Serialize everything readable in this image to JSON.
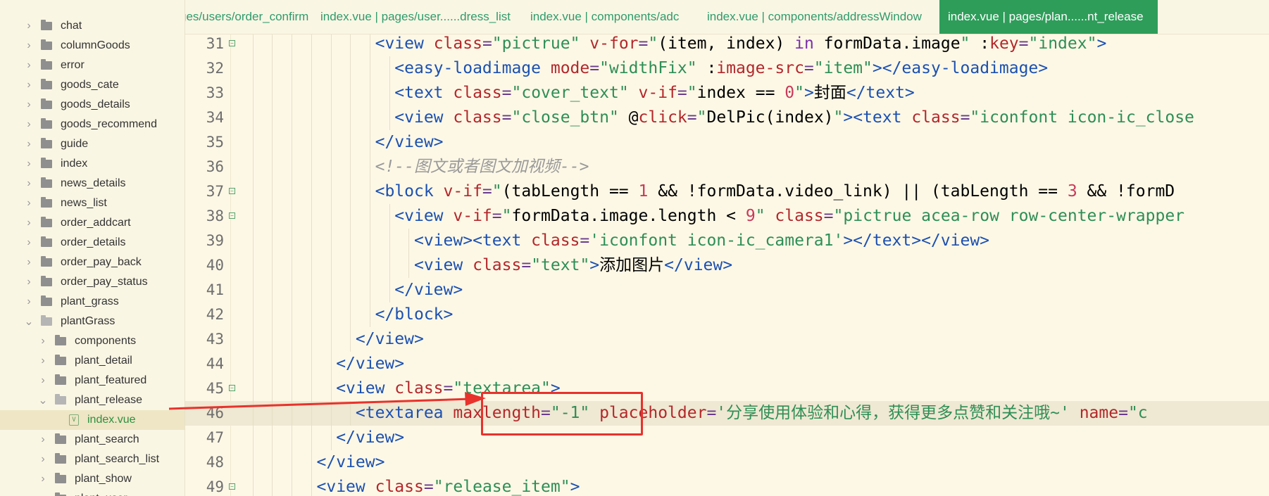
{
  "sidebar": {
    "items": [
      {
        "label": "chat",
        "level": 0,
        "type": "folder",
        "expanded": false
      },
      {
        "label": "columnGoods",
        "level": 0,
        "type": "folder",
        "expanded": false
      },
      {
        "label": "error",
        "level": 0,
        "type": "folder",
        "expanded": false
      },
      {
        "label": "goods_cate",
        "level": 0,
        "type": "folder",
        "expanded": false
      },
      {
        "label": "goods_details",
        "level": 0,
        "type": "folder",
        "expanded": false
      },
      {
        "label": "goods_recommend",
        "level": 0,
        "type": "folder",
        "expanded": false
      },
      {
        "label": "guide",
        "level": 0,
        "type": "folder",
        "expanded": false
      },
      {
        "label": "index",
        "level": 0,
        "type": "folder",
        "expanded": false
      },
      {
        "label": "news_details",
        "level": 0,
        "type": "folder",
        "expanded": false
      },
      {
        "label": "news_list",
        "level": 0,
        "type": "folder",
        "expanded": false
      },
      {
        "label": "order_addcart",
        "level": 0,
        "type": "folder",
        "expanded": false
      },
      {
        "label": "order_details",
        "level": 0,
        "type": "folder",
        "expanded": false
      },
      {
        "label": "order_pay_back",
        "level": 0,
        "type": "folder",
        "expanded": false
      },
      {
        "label": "order_pay_status",
        "level": 0,
        "type": "folder",
        "expanded": false
      },
      {
        "label": "plant_grass",
        "level": 0,
        "type": "folder",
        "expanded": false
      },
      {
        "label": "plantGrass",
        "level": 0,
        "type": "folder",
        "expanded": true
      },
      {
        "label": "components",
        "level": 1,
        "type": "folder",
        "expanded": false
      },
      {
        "label": "plant_detail",
        "level": 1,
        "type": "folder",
        "expanded": false
      },
      {
        "label": "plant_featured",
        "level": 1,
        "type": "folder",
        "expanded": false
      },
      {
        "label": "plant_release",
        "level": 1,
        "type": "folder",
        "expanded": true
      },
      {
        "label": "index.vue",
        "level": 2,
        "type": "file",
        "selected": true
      },
      {
        "label": "plant_search",
        "level": 1,
        "type": "folder",
        "expanded": false
      },
      {
        "label": "plant_search_list",
        "level": 1,
        "type": "folder",
        "expanded": false
      },
      {
        "label": "plant_show",
        "level": 1,
        "type": "folder",
        "expanded": false
      },
      {
        "label": "plant_user",
        "level": 1,
        "type": "folder",
        "expanded": false
      }
    ]
  },
  "tabs": [
    {
      "label": "ges/users/order_confirm",
      "active": false
    },
    {
      "label": "index.vue | pages/user......dress_list",
      "active": false
    },
    {
      "label": "index.vue | components/adc",
      "active": false
    },
    {
      "label": "index.vue | components/addressWindow",
      "active": false
    },
    {
      "label": "index.vue | pages/plan......nt_release",
      "active": true
    }
  ],
  "editor": {
    "highlighted_line": 46,
    "lines": [
      {
        "num": "31",
        "fold": true,
        "indent": 8,
        "tokens": [
          [
            "t",
            "<view "
          ],
          [
            "a",
            "class"
          ],
          [
            "o",
            "="
          ],
          [
            "s",
            "\"pictrue\""
          ],
          [
            "p",
            " "
          ],
          [
            "a",
            "v-for"
          ],
          [
            "o",
            "="
          ],
          [
            "s",
            "\""
          ],
          [
            "p",
            "(item, index) "
          ],
          [
            "k",
            "in"
          ],
          [
            "p",
            " formData.image"
          ],
          [
            "s",
            "\""
          ],
          [
            "p",
            " :"
          ],
          [
            "a",
            "key"
          ],
          [
            "o",
            "="
          ],
          [
            "s",
            "\"index\""
          ],
          [
            "t",
            ">"
          ]
        ]
      },
      {
        "num": "32",
        "fold": false,
        "indent": 9,
        "tokens": [
          [
            "t",
            "<easy-loadimage "
          ],
          [
            "a",
            "mode"
          ],
          [
            "o",
            "="
          ],
          [
            "s",
            "\"widthFix\""
          ],
          [
            "p",
            " :"
          ],
          [
            "a",
            "image-src"
          ],
          [
            "o",
            "="
          ],
          [
            "s",
            "\"item\""
          ],
          [
            "t",
            "></easy-loadimage>"
          ]
        ]
      },
      {
        "num": "33",
        "fold": false,
        "indent": 9,
        "tokens": [
          [
            "t",
            "<text "
          ],
          [
            "a",
            "class"
          ],
          [
            "o",
            "="
          ],
          [
            "s",
            "\"cover_text\""
          ],
          [
            "p",
            " "
          ],
          [
            "a",
            "v-if"
          ],
          [
            "o",
            "="
          ],
          [
            "s",
            "\""
          ],
          [
            "p",
            "index == "
          ],
          [
            "n",
            "0"
          ],
          [
            "s",
            "\""
          ],
          [
            "t",
            ">"
          ],
          [
            "p",
            "封面"
          ],
          [
            "t",
            "</text>"
          ]
        ]
      },
      {
        "num": "34",
        "fold": false,
        "indent": 9,
        "tokens": [
          [
            "t",
            "<view "
          ],
          [
            "a",
            "class"
          ],
          [
            "o",
            "="
          ],
          [
            "s",
            "\"close_btn\""
          ],
          [
            "p",
            " @"
          ],
          [
            "a",
            "click"
          ],
          [
            "o",
            "="
          ],
          [
            "s",
            "\""
          ],
          [
            "p",
            "DelPic(index)"
          ],
          [
            "s",
            "\""
          ],
          [
            "t",
            "><text "
          ],
          [
            "a",
            "class"
          ],
          [
            "o",
            "="
          ],
          [
            "s",
            "\"iconfont icon-ic_close"
          ]
        ]
      },
      {
        "num": "35",
        "fold": false,
        "indent": 8,
        "tokens": [
          [
            "t",
            "</view>"
          ]
        ]
      },
      {
        "num": "36",
        "fold": false,
        "indent": 8,
        "tokens": [
          [
            "c",
            "<!--图文或者图文加视频-->"
          ]
        ]
      },
      {
        "num": "37",
        "fold": true,
        "indent": 8,
        "tokens": [
          [
            "t",
            "<block "
          ],
          [
            "a",
            "v-if"
          ],
          [
            "o",
            "="
          ],
          [
            "s",
            "\""
          ],
          [
            "p",
            "(tabLength == "
          ],
          [
            "n",
            "1"
          ],
          [
            "p",
            " && !formData.video_link) || (tabLength == "
          ],
          [
            "n",
            "3"
          ],
          [
            "p",
            " && !formD"
          ]
        ]
      },
      {
        "num": "38",
        "fold": true,
        "indent": 9,
        "tokens": [
          [
            "t",
            "<view "
          ],
          [
            "a",
            "v-if"
          ],
          [
            "o",
            "="
          ],
          [
            "s",
            "\""
          ],
          [
            "p",
            "formData.image.length < "
          ],
          [
            "n",
            "9"
          ],
          [
            "s",
            "\""
          ],
          [
            "p",
            " "
          ],
          [
            "a",
            "class"
          ],
          [
            "o",
            "="
          ],
          [
            "s",
            "\"pictrue acea-row row-center-wrapper"
          ]
        ]
      },
      {
        "num": "39",
        "fold": false,
        "indent": 10,
        "tokens": [
          [
            "t",
            "<view><text "
          ],
          [
            "a",
            "class"
          ],
          [
            "o",
            "="
          ],
          [
            "s",
            "'iconfont icon-ic_camera1'"
          ],
          [
            "t",
            "></text></view>"
          ]
        ]
      },
      {
        "num": "40",
        "fold": false,
        "indent": 10,
        "tokens": [
          [
            "t",
            "<view "
          ],
          [
            "a",
            "class"
          ],
          [
            "o",
            "="
          ],
          [
            "s",
            "\"text\""
          ],
          [
            "t",
            ">"
          ],
          [
            "p",
            "添加图片"
          ],
          [
            "t",
            "</view>"
          ]
        ]
      },
      {
        "num": "41",
        "fold": false,
        "indent": 9,
        "tokens": [
          [
            "t",
            "</view>"
          ]
        ]
      },
      {
        "num": "42",
        "fold": false,
        "indent": 8,
        "tokens": [
          [
            "t",
            "</block>"
          ]
        ]
      },
      {
        "num": "43",
        "fold": false,
        "indent": 7,
        "tokens": [
          [
            "t",
            "</view>"
          ]
        ]
      },
      {
        "num": "44",
        "fold": false,
        "indent": 6,
        "tokens": [
          [
            "t",
            "</view>"
          ]
        ]
      },
      {
        "num": "45",
        "fold": true,
        "indent": 6,
        "tokens": [
          [
            "t",
            "<view "
          ],
          [
            "a",
            "class"
          ],
          [
            "o",
            "="
          ],
          [
            "s",
            "\"textarea\""
          ],
          [
            "t",
            ">"
          ]
        ]
      },
      {
        "num": "46",
        "fold": false,
        "indent": 7,
        "tokens": [
          [
            "t",
            "<textarea "
          ],
          [
            "a",
            "maxlength"
          ],
          [
            "o",
            "="
          ],
          [
            "s",
            "\"-1\""
          ],
          [
            "p",
            " "
          ],
          [
            "a",
            "placeholder"
          ],
          [
            "o",
            "="
          ],
          [
            "s",
            "'分享使用体验和心得，获得更多点赞和关注哦~'"
          ],
          [
            "p",
            " "
          ],
          [
            "a",
            "name"
          ],
          [
            "o",
            "="
          ],
          [
            "s",
            "\"c"
          ]
        ]
      },
      {
        "num": "47",
        "fold": false,
        "indent": 6,
        "tokens": [
          [
            "t",
            "</view>"
          ]
        ]
      },
      {
        "num": "48",
        "fold": false,
        "indent": 5,
        "tokens": [
          [
            "t",
            "</view>"
          ]
        ]
      },
      {
        "num": "49",
        "fold": true,
        "indent": 5,
        "tokens": [
          [
            "t",
            "<view "
          ],
          [
            "a",
            "class"
          ],
          [
            "o",
            "="
          ],
          [
            "s",
            "\"release_item\""
          ],
          [
            "t",
            ">"
          ]
        ]
      }
    ]
  },
  "colors": {
    "background": "#fdf8e6",
    "tab_active": "#2e9d5a",
    "annotation": "#e8322c",
    "tag": "#1c50b0",
    "attribute": "#b3272b",
    "string": "#2e8e55"
  }
}
